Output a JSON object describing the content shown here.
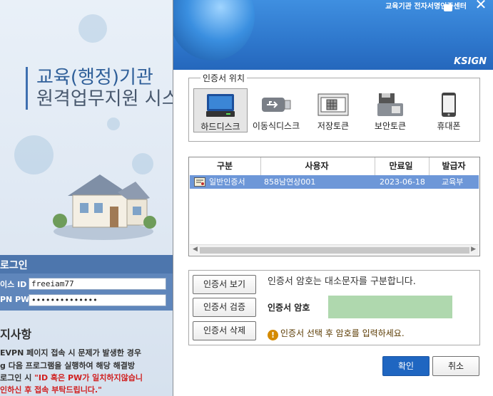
{
  "background_page": {
    "title_line1": "교육(행정)기관",
    "title_line2": "원격업무지원 시스",
    "login_header": "로그인",
    "id_label": "이스 ID",
    "id_value": "freeiam77",
    "pw_label": "PN PW",
    "pw_value": "••••••••••••••",
    "notice_title": "지사항",
    "notice_lines": [
      "EVPN 페이지 접속 시 문제가 발생한 경우",
      "g 다음 프로그램을 실행하여 해당 해결방",
      "로그인 시 ",
      "\"ID 혹은 PW가 일치하지않습니",
      "인하신 후 접속 부탁드립니다.\""
    ]
  },
  "dialog": {
    "banner_title": "교육기관 전자서명인증센터",
    "brand": "KSIGN",
    "location_group": {
      "legend": "인증서 위치",
      "items": [
        {
          "label": "하드디스크",
          "icon": "hard-disk-icon",
          "selected": true
        },
        {
          "label": "이동식디스크",
          "icon": "usb-drive-icon",
          "selected": false
        },
        {
          "label": "저장토큰",
          "icon": "storage-token-icon",
          "selected": false
        },
        {
          "label": "보안토큰",
          "icon": "security-token-icon",
          "selected": false
        },
        {
          "label": "휴대폰",
          "icon": "mobile-phone-icon",
          "selected": false
        }
      ]
    },
    "cert_table": {
      "headers": [
        "구분",
        "사용자",
        "만료일",
        "발급자"
      ],
      "rows": [
        {
          "type": "일반인증서",
          "user": "858남연상001",
          "expiry": "2023-06-18",
          "issuer": "교육부"
        }
      ]
    },
    "buttons": {
      "view": "인증서 보기",
      "verify": "인증서 검증",
      "delete": "인증서 삭제",
      "ok": "확인",
      "cancel": "취소"
    },
    "case_note": "인증서 암호는 대소문자를 구분합니다.",
    "password_label": "인증서 암호",
    "password_value": "",
    "warning": "인증서 선택 후 암호를 입력하세요.",
    "colors": {
      "banner_blue": "#2e77cc",
      "selected_row": "#6d97d8",
      "password_field": "#afd8ae",
      "ok_button": "#1f66c1"
    }
  }
}
